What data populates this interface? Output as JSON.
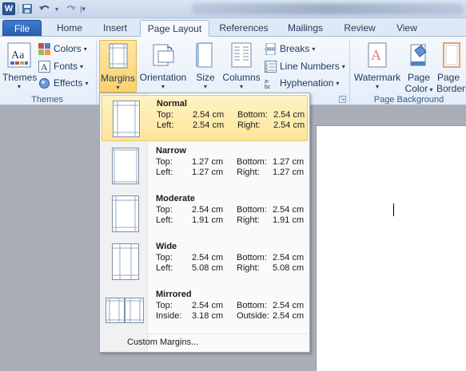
{
  "qat": {
    "app_icon": "W",
    "undo_icon": "undo-icon",
    "redo_icon": "redo-icon",
    "save_icon": "save-icon"
  },
  "tabs": [
    {
      "label": "File"
    },
    {
      "label": "Home"
    },
    {
      "label": "Insert"
    },
    {
      "label": "Page Layout"
    },
    {
      "label": "References"
    },
    {
      "label": "Mailings"
    },
    {
      "label": "Review"
    },
    {
      "label": "View"
    }
  ],
  "ribbon": {
    "themes_group": {
      "label": "Themes",
      "themes_button": "Themes",
      "colors": "Colors",
      "fonts": "Fonts",
      "effects": "Effects"
    },
    "page_setup_group": {
      "margins": "Margins",
      "orientation": "Orientation",
      "size": "Size",
      "columns": "Columns",
      "breaks": "Breaks",
      "line_numbers": "Line Numbers",
      "hyphenation": "Hyphenation"
    },
    "page_background_group": {
      "label": "Page Background",
      "watermark": "Watermark",
      "page_color_1": "Page",
      "page_color_2": "Color",
      "page_borders_1": "Page",
      "page_borders_2": "Borders"
    }
  },
  "margins_menu": {
    "items": [
      {
        "name": "Normal",
        "r1a": "Top:",
        "r1b": "2.54 cm",
        "r1c": "Bottom:",
        "r1d": "2.54 cm",
        "r2a": "Left:",
        "r2b": "2.54 cm",
        "r2c": "Right:",
        "r2d": "2.54 cm"
      },
      {
        "name": "Narrow",
        "r1a": "Top:",
        "r1b": "1.27 cm",
        "r1c": "Bottom:",
        "r1d": "1.27 cm",
        "r2a": "Left:",
        "r2b": "1.27 cm",
        "r2c": "Right:",
        "r2d": "1.27 cm"
      },
      {
        "name": "Moderate",
        "r1a": "Top:",
        "r1b": "2.54 cm",
        "r1c": "Bottom:",
        "r1d": "2.54 cm",
        "r2a": "Left:",
        "r2b": "1.91 cm",
        "r2c": "Right:",
        "r2d": "1.91 cm"
      },
      {
        "name": "Wide",
        "r1a": "Top:",
        "r1b": "2.54 cm",
        "r1c": "Bottom:",
        "r1d": "2.54 cm",
        "r2a": "Left:",
        "r2b": "5.08 cm",
        "r2c": "Right:",
        "r2d": "5.08 cm"
      },
      {
        "name": "Mirrored",
        "r1a": "Top:",
        "r1b": "2.54 cm",
        "r1c": "Bottom:",
        "r1d": "2.54 cm",
        "r2a": "Inside:",
        "r2b": "3.18 cm",
        "r2c": "Outside:",
        "r2d": "2.54 cm"
      }
    ],
    "custom": "Custom Margins..."
  },
  "colors": {
    "accent": "#2b5797",
    "highlight": "#fde59a",
    "ribbon": "#e4edf8"
  }
}
